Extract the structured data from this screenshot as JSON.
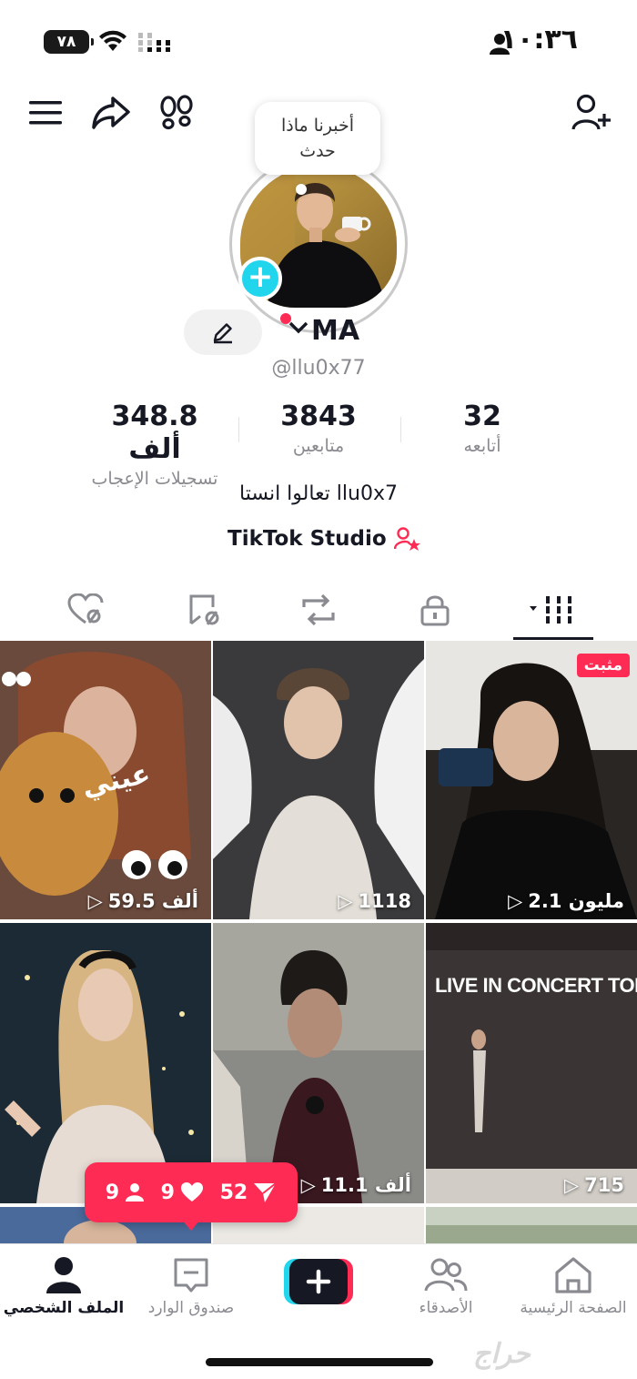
{
  "status_bar": {
    "battery": "٧٨",
    "time": "١٠:٣٦"
  },
  "profile": {
    "bubble_text_line1": "أخبرنا ماذا",
    "bubble_text_line2": "حدث",
    "name": "MA",
    "handle": "@llu0x77",
    "stats": {
      "likes_value": "348.8 ألف",
      "likes_label": "تسجيلات الإعجاب",
      "followers_value": "3843",
      "followers_label": "متابعين",
      "following_value": "32",
      "following_label": "أتابعه"
    },
    "bio": "تعالوا انستا llu0x7",
    "studio_link": "TikTok Studio"
  },
  "grid": {
    "videos": [
      {
        "views": "59.5 ألف",
        "caption": "عيني"
      },
      {
        "views": "1118"
      },
      {
        "views": "2.1 مليون",
        "badge": "مثبت"
      },
      {
        "views": ""
      },
      {
        "views": "11.1 ألف"
      },
      {
        "views": "715",
        "caption": "LIVE IN CONCERT TONIG"
      }
    ]
  },
  "notification": {
    "messages": "52",
    "likes": "9",
    "followers": "9"
  },
  "bottom_nav": {
    "home": "الصفحة الرئيسية",
    "friends": "الأصدقاء",
    "inbox": "صندوق الوارد",
    "profile": "الملف الشخصي"
  },
  "watermark": "حراج",
  "colors": {
    "accent": "#fe2c55",
    "cyan": "#20d5ec",
    "text": "#161823",
    "muted": "#8a8b91"
  }
}
